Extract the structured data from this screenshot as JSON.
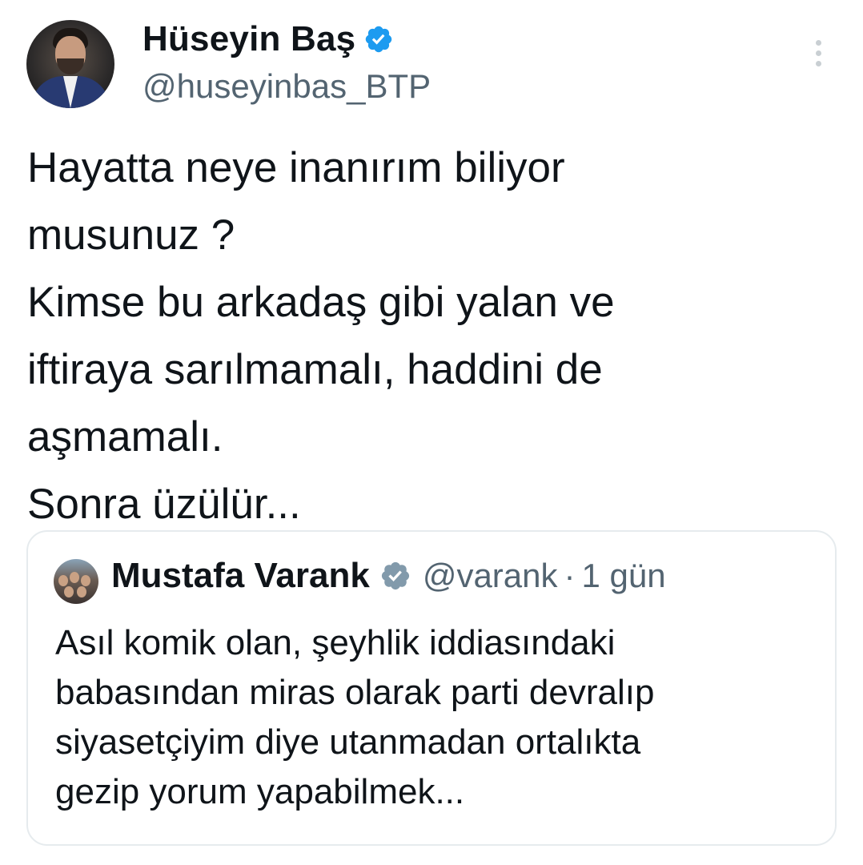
{
  "author": {
    "display_name": "Hüseyin Baş",
    "handle": "@huseyinbas_BTP",
    "verified": true,
    "verified_color": "#1d9bf0"
  },
  "tweet": {
    "lines": [
      "Hayatta neye inanırım biliyor",
      "musunuz ?",
      "Kimse bu arkadaş gibi yalan ve",
      "iftiraya sarılmamalı, haddini de",
      "aşmamalı.",
      "Sonra üzülür..."
    ]
  },
  "quote": {
    "display_name": "Mustafa Varank",
    "verified": true,
    "verified_color": "#829aab",
    "handle": "@varank",
    "separator": "·",
    "time": "1 gün",
    "lines": [
      "Asıl komik olan, şeyhlik iddiasındaki",
      "babasından miras olarak parti devralıp",
      "siyasetçiyim diye utanmadan ortalıkta",
      "gezip yorum yapabilmek..."
    ]
  },
  "icons": {
    "more": "more-vertical-icon",
    "verified": "verified-badge-icon"
  }
}
